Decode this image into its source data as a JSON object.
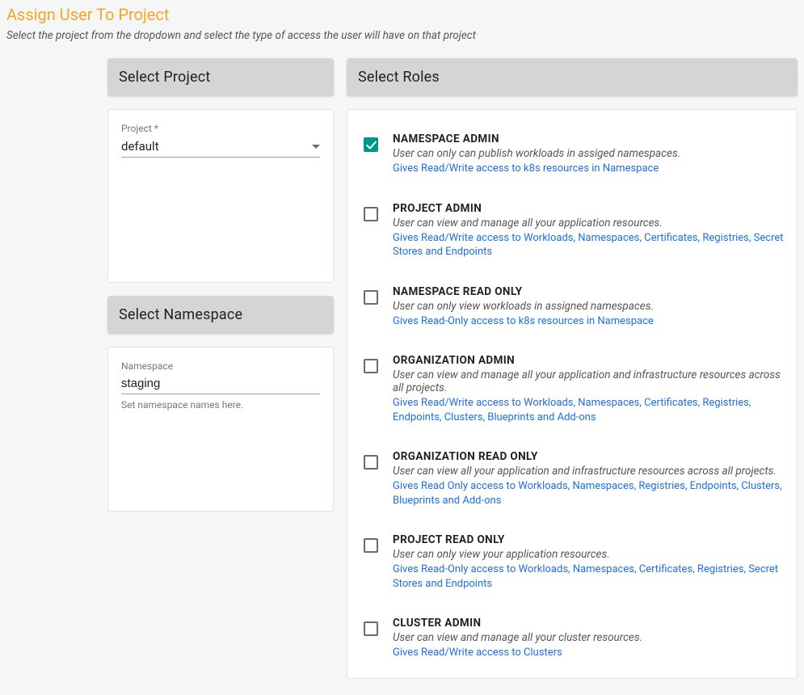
{
  "header": {
    "title": "Assign User To Project",
    "subtitle": "Select the project from the dropdown and select the type of access the user will have on that project"
  },
  "panels": {
    "project_header": "Select Project",
    "namespace_header": "Select Namespace",
    "roles_header": "Select Roles"
  },
  "project": {
    "field_label": "Project *",
    "selected_value": "default"
  },
  "namespace": {
    "field_label": "Namespace",
    "value": "staging",
    "helper": "Set namespace names here."
  },
  "roles": [
    {
      "id": "namespace-admin",
      "title": "NAMESPACE ADMIN",
      "desc": "User can only can publish workloads in assiged namespaces.",
      "detail": "Gives Read/Write access to k8s resources in Namespace",
      "checked": true
    },
    {
      "id": "project-admin",
      "title": "PROJECT ADMIN",
      "desc": "User can view and manage all your application resources.",
      "detail": "Gives Read/Write access to Workloads, Namespaces, Certificates, Registries, Secret Stores and Endpoints",
      "checked": false
    },
    {
      "id": "namespace-read-only",
      "title": "NAMESPACE READ ONLY",
      "desc": "User can only view workloads in assigned namespaces.",
      "detail": "Gives Read-Only access to k8s resources in Namespace",
      "checked": false
    },
    {
      "id": "organization-admin",
      "title": "ORGANIZATION ADMIN",
      "desc": "User can view and manage all your application and infrastructure resources across all projects.",
      "detail": "Gives Read/Write access to Workloads, Namespaces, Certificates, Registries, Endpoints, Clusters, Blueprints and Add-ons",
      "checked": false
    },
    {
      "id": "organization-read-only",
      "title": "ORGANIZATION READ ONLY",
      "desc": "User can view all your application and infrastructure resources across all projects.",
      "detail": "Gives Read Only access to Workloads, Namespaces, Registries, Endpoints, Clusters, Blueprints and Add-ons",
      "checked": false
    },
    {
      "id": "project-read-only",
      "title": "PROJECT READ ONLY",
      "desc": "User can only view your application resources.",
      "detail": "Gives Read-Only access to Workloads, Namespaces, Certificates, Registries, Secret Stores and Endpoints",
      "checked": false
    },
    {
      "id": "cluster-admin",
      "title": "CLUSTER ADMIN",
      "desc": "User can view and manage all your cluster resources.",
      "detail": "Gives Read/Write access to Clusters",
      "checked": false
    }
  ]
}
